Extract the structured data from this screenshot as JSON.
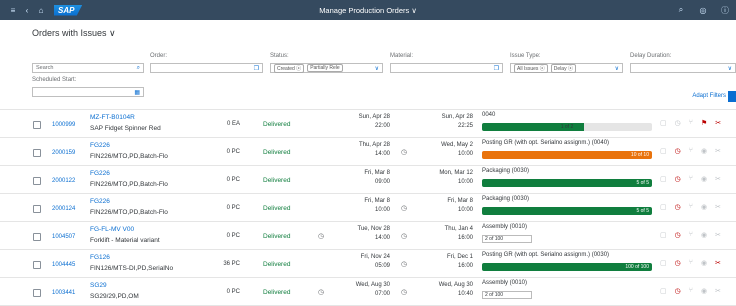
{
  "shell": {
    "logo": "SAP",
    "title": "Manage Production Orders ∨",
    "menu_icon": "≡",
    "back_icon": "‹",
    "home_icon": "⌂",
    "search_icon": "⌕",
    "settings_icon": "◎",
    "help_icon": "ⓘ"
  },
  "header": {
    "variant_title": "Orders with Issues ∨",
    "search_placeholder": "Search",
    "search_icon": "⌕",
    "order_label": "Order:",
    "status_label": "Status:",
    "status_tokens": [
      "Created ⓧ",
      "Partially Rele"
    ],
    "material_label": "Material:",
    "issue_label": "Issue Type:",
    "issue_tokens": [
      "All Issues ⓧ",
      "Delay ⓧ"
    ],
    "delay_label": "Delay Duration:",
    "scheduled_label": "Scheduled Start:",
    "value_help": "❐",
    "dropdown": "∨",
    "calendar_icon": "▦",
    "adapt_filters": "Adapt Filters"
  },
  "orders": [
    {
      "order": "1000999",
      "material": "MZ-FT-B0104R",
      "desc": "SAP Fidget Spinner Red",
      "qty": "0 EA",
      "status": "Delivered",
      "start_day": "Sun, Apr 28",
      "start_time": "22:00",
      "end_day": "Sun, Apr 28",
      "end_time": "22:25",
      "clock1": false,
      "clock2": false,
      "op": "0040",
      "pbar": "bar",
      "pct": 60,
      "label": "1 of 2",
      "label_center": true,
      "color": "#107e3e",
      "acts": [
        "▢",
        "◷",
        "⑂",
        "⚑",
        "✂"
      ],
      "red": [
        false,
        false,
        false,
        true,
        true
      ]
    },
    {
      "order": "2000159",
      "material": "FG226",
      "desc": "FIN226/MTO,PD,Batch-Flo",
      "qty": "0 PC",
      "status": "Delivered",
      "start_day": "Thu, Apr 28",
      "start_time": "14:00",
      "end_day": "Wed, May 2",
      "end_time": "10:00",
      "clock1": false,
      "clock2": true,
      "op": "Posting GR (with opt. Serialno assignm.) (0040)",
      "pbar": "bar",
      "pct": 100,
      "label": "10 of 10",
      "label_center": false,
      "color": "#e9730c",
      "acts": [
        "▢",
        "◷",
        "⑂",
        "◉",
        "✂"
      ],
      "red": [
        false,
        true,
        false,
        false,
        false
      ]
    },
    {
      "order": "2000122",
      "material": "FG226",
      "desc": "FIN226/MTO,PD,Batch-Flo",
      "qty": "0 PC",
      "status": "Delivered",
      "start_day": "Fri, Mar 8",
      "start_time": "09:00",
      "end_day": "Mon, Mar 12",
      "end_time": "10:00",
      "clock1": false,
      "clock2": false,
      "op": "Packaging (0030)",
      "pbar": "bar",
      "pct": 100,
      "label": "5 of 5",
      "label_center": false,
      "color": "#107e3e",
      "acts": [
        "▢",
        "◷",
        "⑂",
        "◉",
        "✂"
      ],
      "red": [
        false,
        true,
        false,
        false,
        false
      ]
    },
    {
      "order": "2000124",
      "material": "FG226",
      "desc": "FIN226/MTO,PD,Batch-Flo",
      "qty": "0 PC",
      "status": "Delivered",
      "start_day": "Fri, Mar 8",
      "start_time": "10:00",
      "end_day": "Fri, Mar 8",
      "end_time": "10:00",
      "clock1": false,
      "clock2": true,
      "op": "Packaging (0030)",
      "pbar": "bar",
      "pct": 100,
      "label": "5 of 5",
      "label_center": false,
      "color": "#107e3e",
      "acts": [
        "▢",
        "◷",
        "⑂",
        "◉",
        "✂"
      ],
      "red": [
        false,
        true,
        false,
        false,
        false
      ]
    },
    {
      "order": "1004507",
      "material": "FG-FL-MV V00",
      "desc": "Forklift - Material variant",
      "qty": "0 PC",
      "status": "Delivered",
      "start_day": "Tue, Nov 28",
      "start_time": "14:00",
      "end_day": "Thu, Jan 4",
      "end_time": "16:00",
      "clock1": true,
      "clock2": true,
      "op": "Assembly (0010)",
      "pbar": "box",
      "pct": 0,
      "label": "2 of 100",
      "label_center": false,
      "color": "#107e3e",
      "acts": [
        "▢",
        "◷",
        "⑂",
        "◉",
        "✂"
      ],
      "red": [
        false,
        true,
        false,
        false,
        false
      ]
    },
    {
      "order": "1004445",
      "material": "FG126",
      "desc": "FIN126/MTS-DI,PD,SerialNo",
      "qty": "36 PC",
      "status": "Delivered",
      "start_day": "Fri, Nov 24",
      "start_time": "05:09",
      "end_day": "Fri, Dec 1",
      "end_time": "16:00",
      "clock1": false,
      "clock2": true,
      "op": "Posting GR (with opt. Serialno assignm.) (0030)",
      "pbar": "bar",
      "pct": 100,
      "label": "100 of 100",
      "label_center": false,
      "color": "#107e3e",
      "acts": [
        "▢",
        "◷",
        "⑂",
        "◉",
        "✂"
      ],
      "red": [
        false,
        true,
        false,
        false,
        true
      ]
    },
    {
      "order": "1003441",
      "material": "SG29",
      "desc": "SG29/29,PD,OM",
      "qty": "0 PC",
      "status": "Delivered",
      "start_day": "Wed, Aug 30",
      "start_time": "07:00",
      "end_day": "Wed, Aug 30",
      "end_time": "10:40",
      "clock1": true,
      "clock2": true,
      "op": "Assembly (0010)",
      "pbar": "box",
      "pct": 0,
      "label": "2 of 100",
      "label_center": false,
      "color": "#107e3e",
      "acts": [
        "▢",
        "◷",
        "⑂",
        "◉",
        "✂"
      ],
      "red": [
        false,
        true,
        false,
        false,
        false
      ]
    }
  ]
}
